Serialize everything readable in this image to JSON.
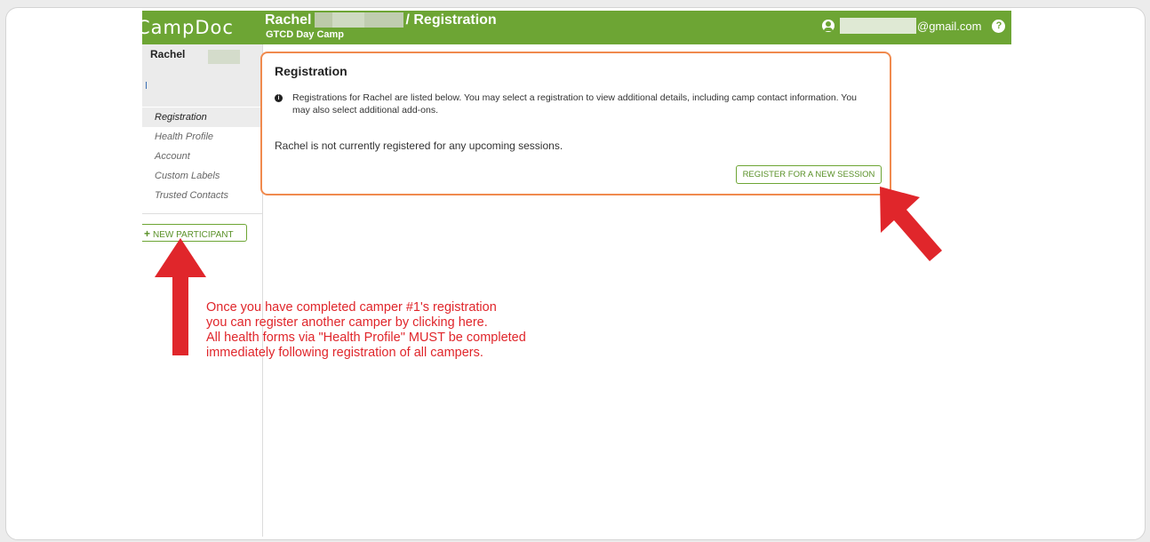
{
  "app": {
    "logo": "CampDoc",
    "title_name": "Rachel",
    "title_section": "/ Registration",
    "subtitle": "GTCD Day Camp",
    "email_suffix": "@gmail.com",
    "help_icon": "question-circle-icon",
    "user_icon": "user-circle-icon"
  },
  "sidebar": {
    "participant": "Rachel",
    "nav": [
      {
        "label": "Registration",
        "active": true
      },
      {
        "label": "Health Profile"
      },
      {
        "label": "Account"
      },
      {
        "label": "Custom Labels"
      },
      {
        "label": "Trusted Contacts"
      }
    ],
    "new_participant": "NEW PARTICIPANT"
  },
  "card": {
    "title": "Registration",
    "info": "Registrations for Rachel are listed below. You may select a registration to view additional details, including camp contact information. You may also select additional add-ons.",
    "empty": "Rachel is not currently registered for any upcoming sessions.",
    "register_button": "REGISTER FOR A NEW SESSION"
  },
  "annotation": {
    "lines": [
      "Once you have completed camper #1's registration",
      "you can register another camper by clicking here.",
      "All health forms via \"Health Profile\" MUST be completed",
      "immediately following registration of all campers."
    ]
  },
  "colors": {
    "brand_green": "#6da534",
    "highlight_orange": "#f08a4e",
    "arrow_red": "#e0262b"
  }
}
